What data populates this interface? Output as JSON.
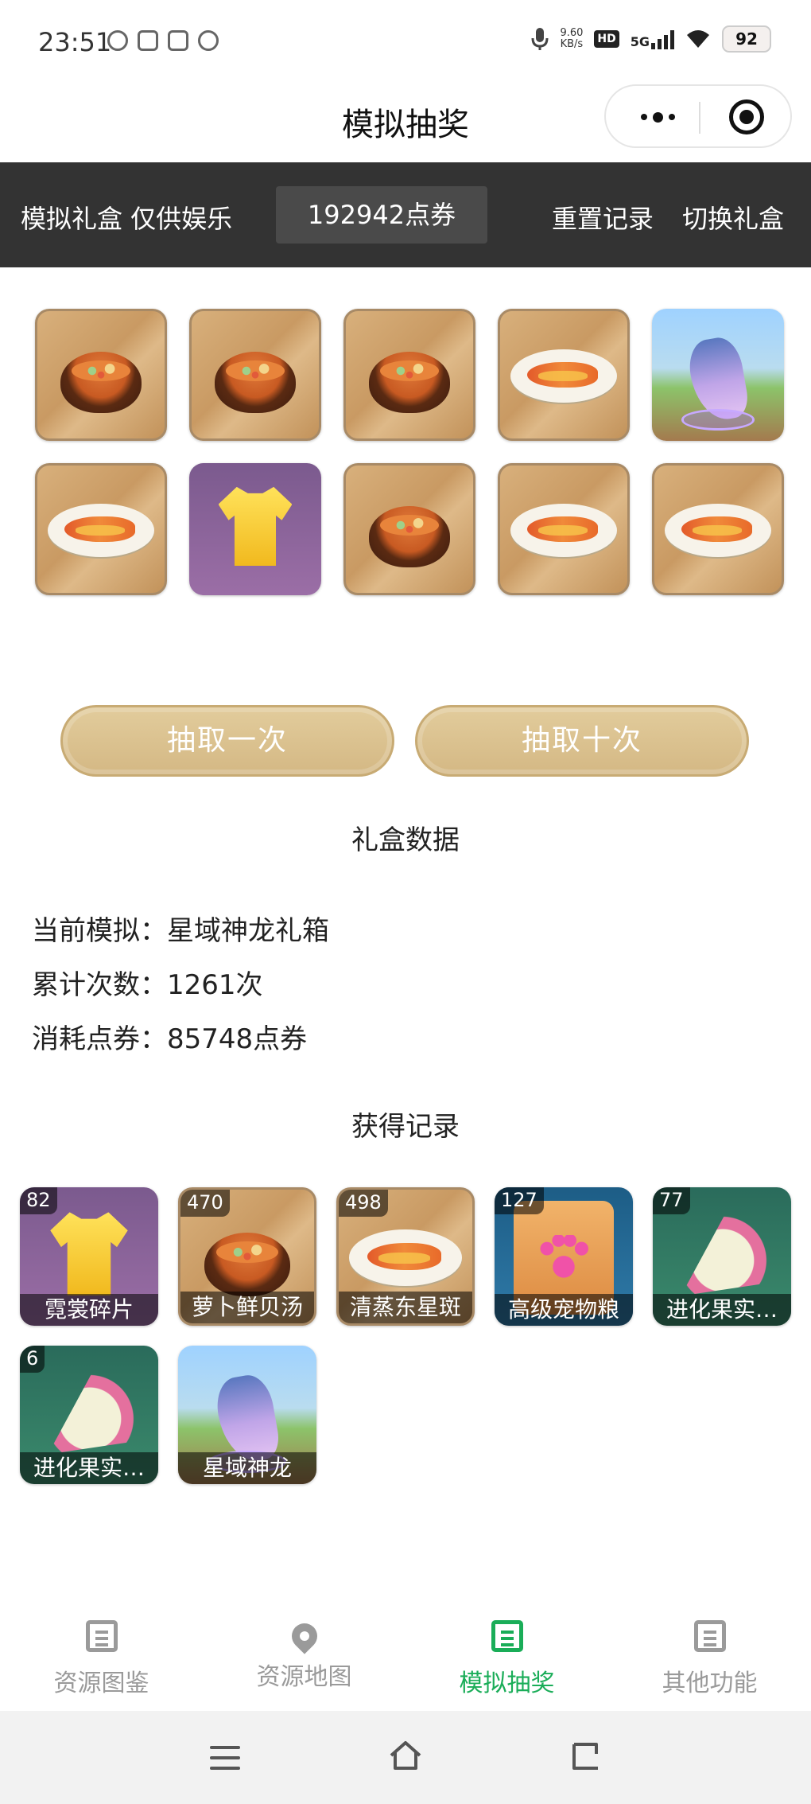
{
  "status_bar": {
    "time": "23:51",
    "net_speed": "9.60",
    "net_speed_unit": "KB/s",
    "hd": "HD",
    "network": "5G",
    "battery": "92"
  },
  "titlebar": {
    "title": "模拟抽奖",
    "more_icon": "more-dots-icon",
    "close_icon": "target-circle-icon"
  },
  "header": {
    "disclaimer": "模拟礼盒 仅供娱乐",
    "points": "192942点券",
    "reset_label": "重置记录",
    "switch_label": "切换礼盒"
  },
  "draw_results": [
    {
      "item": "soup",
      "bg": "wood"
    },
    {
      "item": "soup",
      "bg": "wood"
    },
    {
      "item": "soup",
      "bg": "wood"
    },
    {
      "item": "fish",
      "bg": "wood"
    },
    {
      "item": "dragon",
      "bg": "scene"
    },
    {
      "item": "fish",
      "bg": "wood"
    },
    {
      "item": "shirt",
      "bg": "purple"
    },
    {
      "item": "soup",
      "bg": "wood"
    },
    {
      "item": "fish",
      "bg": "wood"
    },
    {
      "item": "fish",
      "bg": "wood"
    }
  ],
  "buttons": {
    "draw_once": "抽取一次",
    "draw_ten": "抽取十次"
  },
  "box_data": {
    "title": "礼盒数据",
    "current_label": "当前模拟：",
    "current_value": "星域神龙礼箱",
    "count_label": "累计次数：",
    "count_value": "1261次",
    "cost_label": "消耗点券：",
    "cost_value": "85748点券"
  },
  "records": {
    "title": "获得记录",
    "items": [
      {
        "count": "82",
        "name": "霓裳碎片",
        "item": "shirt",
        "bg": "purple"
      },
      {
        "count": "470",
        "name": "萝卜鲜贝汤",
        "item": "soup",
        "bg": "wood"
      },
      {
        "count": "498",
        "name": "清蒸东星斑",
        "item": "fish",
        "bg": "wood"
      },
      {
        "count": "127",
        "name": "高级宠物粮",
        "item": "bag",
        "bg": "bag"
      },
      {
        "count": "77",
        "name": "进化果实…",
        "item": "fruit",
        "bg": "green"
      },
      {
        "count": "6",
        "name": "进化果实…",
        "item": "fruit",
        "bg": "green"
      },
      {
        "count": "",
        "name": "星域神龙",
        "item": "dragon",
        "bg": "scene"
      }
    ]
  },
  "bottom_nav": {
    "items": [
      {
        "label": "资源图鉴",
        "icon": "list-icon",
        "active": false
      },
      {
        "label": "资源地图",
        "icon": "map-pin-icon",
        "active": false
      },
      {
        "label": "模拟抽奖",
        "icon": "list-icon",
        "active": true
      },
      {
        "label": "其他功能",
        "icon": "list-icon",
        "active": false
      }
    ]
  },
  "colors": {
    "accent": "#1aad58",
    "header_bg": "#333333",
    "button_gold": "#d4b884"
  }
}
